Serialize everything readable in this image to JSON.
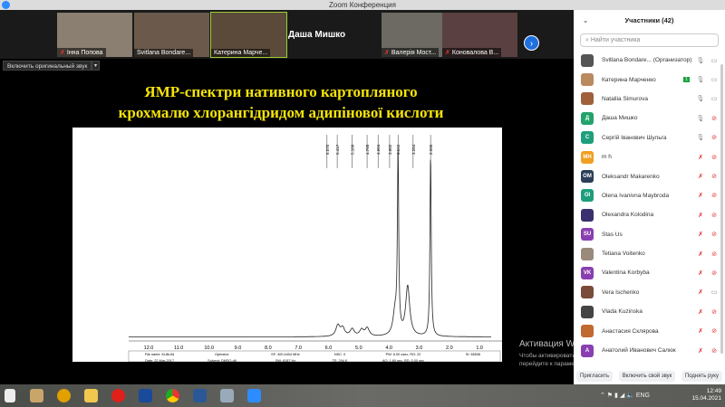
{
  "window": {
    "title": "Zoom Конференция"
  },
  "videos": [
    {
      "name": "Інна Попова",
      "muted": true
    },
    {
      "name": "Svitlana Bondare...",
      "muted": false
    },
    {
      "name": "Катерина Марче...",
      "muted": false,
      "active": true
    },
    {
      "name": "Даша Мишко",
      "video": false
    },
    {
      "name": "Валерія Мост...",
      "muted": true
    },
    {
      "name": "Коновалова В...",
      "muted": true
    }
  ],
  "controls": {
    "original_audio": "Включить оригинальный звук",
    "next": "›"
  },
  "slide": {
    "title_line1": "ЯМР-спектри нативного картопляного",
    "title_line2": "крохмалю хлорангідридом адипінової кислоти",
    "peak_labels": [
      "5.575",
      "5.417",
      "5.100",
      "4.788",
      "4.604",
      "3.682",
      "3.583",
      "3.264",
      "2.506"
    ],
    "axis_ticks": [
      "12.0",
      "11.0",
      "10.0",
      "9.0",
      "8.0",
      "7.0",
      "6.0",
      "5.0",
      "4.0",
      "3.0",
      "2.0",
      "1.0"
    ],
    "table": [
      [
        "File name: M-8k-fid",
        "Operator:",
        "SF: 400.4404 MHz",
        "NSC: 0",
        "PW: 6.00 usec, RG: 22",
        "SI: 65536"
      ],
      [
        "Date: 22-Mar-2017",
        "Solvent: DMSO-d6",
        "SW: 8187 Hz",
        "TE: 294 K",
        "AQ: 1.60 sec, RD: 0.00 sec",
        ""
      ]
    ]
  },
  "participants": {
    "header": "Участники (42)",
    "search_placeholder": "Найти участника",
    "list": [
      {
        "name": "Svitlana Bondare...",
        "role": "(Организатор)",
        "initials": "",
        "color": "#555",
        "mic": "on",
        "cam": "on"
      },
      {
        "name": "Катерина Марченко",
        "badge": "1",
        "initials": "",
        "color": "#b98a5e",
        "mic": "on",
        "cam": "on"
      },
      {
        "name": "Nataliia Simurova",
        "initials": "",
        "color": "#a0603a",
        "mic": "on",
        "cam": "on"
      },
      {
        "name": "Даша Мишко",
        "initials": "Д",
        "color": "#21a36b",
        "mic": "on",
        "cam": "off"
      },
      {
        "name": "Сергій Іванович Шульга",
        "initials": "С",
        "color": "#1f9e7c",
        "mic": "on",
        "cam": "off"
      },
      {
        "name": "m h",
        "initials": "MH",
        "color": "#f0a020",
        "mic": "off",
        "cam": "off"
      },
      {
        "name": "Oleksandr Makarenko",
        "initials": "OM",
        "color": "#2c3e58",
        "mic": "off",
        "cam": "off"
      },
      {
        "name": "Olena Ivanivna Maybroda",
        "initials": "OI",
        "color": "#1f9e7c",
        "mic": "off",
        "cam": "off"
      },
      {
        "name": "Olexandra Kolodina",
        "initials": "",
        "color": "#3a3070",
        "mic": "off",
        "cam": "off"
      },
      {
        "name": "Stas Us",
        "initials": "SU",
        "color": "#8a3fb0",
        "mic": "off",
        "cam": "off"
      },
      {
        "name": "Tetiana Voitenko",
        "initials": "",
        "color": "#9a8a7a",
        "mic": "off",
        "cam": "off"
      },
      {
        "name": "Valentina Korbyba",
        "initials": "VK",
        "color": "#8a3fb0",
        "mic": "off",
        "cam": "off"
      },
      {
        "name": "Vera Ischenko",
        "initials": "",
        "color": "#7a4a3a",
        "mic": "off",
        "cam": "on"
      },
      {
        "name": "Vlada Kuzinska",
        "initials": "",
        "color": "#444",
        "mic": "off",
        "cam": "off"
      },
      {
        "name": "Анастасия Склярова",
        "initials": "",
        "color": "#c06a30",
        "mic": "off",
        "cam": "off"
      },
      {
        "name": "Анатолий Иванович Салюк",
        "initials": "A",
        "color": "#8a3fb0",
        "mic": "off",
        "cam": "off"
      }
    ],
    "buttons": {
      "invite": "Пригласить",
      "unmute": "Включить свой звук",
      "raise_hand": "Поднять руку"
    }
  },
  "watermark": {
    "title": "Активация Windows",
    "text": "Чтобы активировать Windows, перейдите к параметрам компьютера."
  },
  "taskbar": {
    "lang": "ENG",
    "time": "12:49",
    "date": "15.04.2021"
  }
}
